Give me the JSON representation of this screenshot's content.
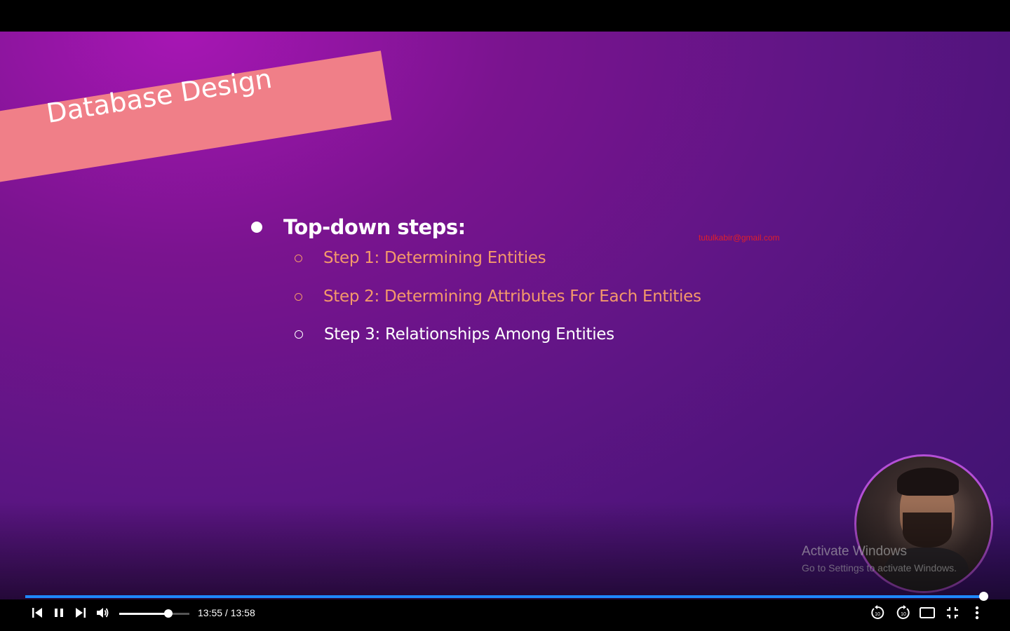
{
  "slide": {
    "banner_title": "Database Design",
    "heading": "Top-down steps:",
    "steps": [
      {
        "label": "Step 1: Determining Entities",
        "color": "#f4996a"
      },
      {
        "label": "Step 2: Determining Attributes For Each Entities",
        "color": "#f4996a"
      },
      {
        "label": "Step 3: Relationships Among Entities",
        "color": "#ffffff"
      }
    ],
    "email": "tutulkabir@gmail.com"
  },
  "watermark": {
    "line1": "Activate Windows",
    "line2": "Go to Settings to activate Windows."
  },
  "player": {
    "progress_fraction": 0.998,
    "volume_fraction": 0.7,
    "time_display": "13:55 / 13:58",
    "accent_color": "#1e88ff",
    "icons": [
      "previous-icon",
      "pause-icon",
      "next-icon",
      "volume-icon",
      "rewind-10-icon",
      "forward-10-icon",
      "theater-mode-icon",
      "exit-fullscreen-icon",
      "more-options-icon"
    ]
  }
}
